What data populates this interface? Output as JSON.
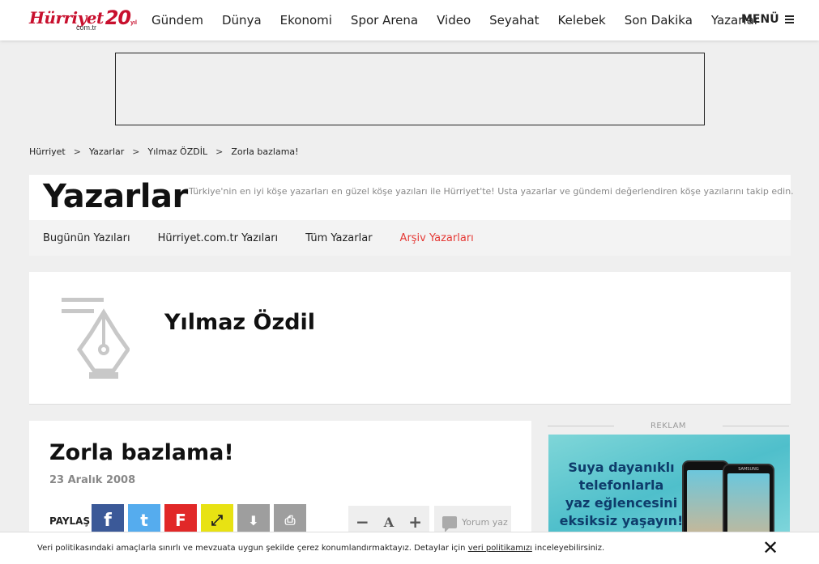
{
  "header": {
    "logo_word": "Hürriyet",
    "logo_sub": "com.tr",
    "logo_anniv": "20",
    "logo_anniv_suffix": "yıl",
    "nav": [
      "Gündem",
      "Dünya",
      "Ekonomi",
      "Spor Arena",
      "Video",
      "Seyahat",
      "Kelebek",
      "Son Dakika",
      "Yazarlar"
    ],
    "menu_label": "MENÜ"
  },
  "breadcrumb": [
    "Hürriyet",
    "Yazarlar",
    "Yılmaz ÖZDİL",
    "Zorla bazlama!"
  ],
  "breadcrumb_sep": ">",
  "section": {
    "title": "Yazarlar",
    "description": "Türkiye'nin en iyi köşe yazarları en güzel köşe yazıları ile Hürriyet'te! Usta yazarlar ve gündemi değerlendiren köşe yazılarını takip edin.",
    "tabs": [
      "Bugünün Yazıları",
      "Hürriyet.com.tr Yazıları",
      "Tüm Yazarlar",
      "Arşiv Yazarları"
    ],
    "active_tab": "Arşiv Yazarları"
  },
  "author": {
    "name": "Yılmaz Özdil",
    "icon": "pen-nib-icon"
  },
  "article": {
    "title": "Zorla bazlama!",
    "date": "23 Aralık 2008",
    "share_label": "PAYLAŞ",
    "share_buttons": [
      {
        "name": "facebook",
        "glyph": "f",
        "color": "#3b5998"
      },
      {
        "name": "twitter",
        "glyph": "t",
        "color": "#55acee"
      },
      {
        "name": "flipboard",
        "glyph": "F",
        "color": "#e12828"
      },
      {
        "name": "fullscreen",
        "glyph": "⤢",
        "color": "#e8e213"
      },
      {
        "name": "download",
        "glyph": "⬇",
        "color": "#9e9e9e"
      },
      {
        "name": "print",
        "glyph": "⎙",
        "color": "#9e9e9e"
      }
    ],
    "font_controls": {
      "decrease": "−",
      "label": "A",
      "increase": "+"
    },
    "comment_label": "Yorum yaz"
  },
  "ad": {
    "label": "REKLAM",
    "promo_lines": [
      "Suya dayanıklı",
      "telefonlarla",
      "yaz eğlencesini",
      "eksiksiz yaşayın!"
    ],
    "phone_brand": "SAMSUNG"
  },
  "cookie": {
    "text_before": "Veri politikasındaki amaçlarla sınırlı ve mevzuata uygun şekilde çerez konumlandırmaktayız. Detaylar için",
    "link": "veri politikamızı",
    "text_after": "inceleyebilirsiniz.",
    "close_glyph": "✕"
  }
}
